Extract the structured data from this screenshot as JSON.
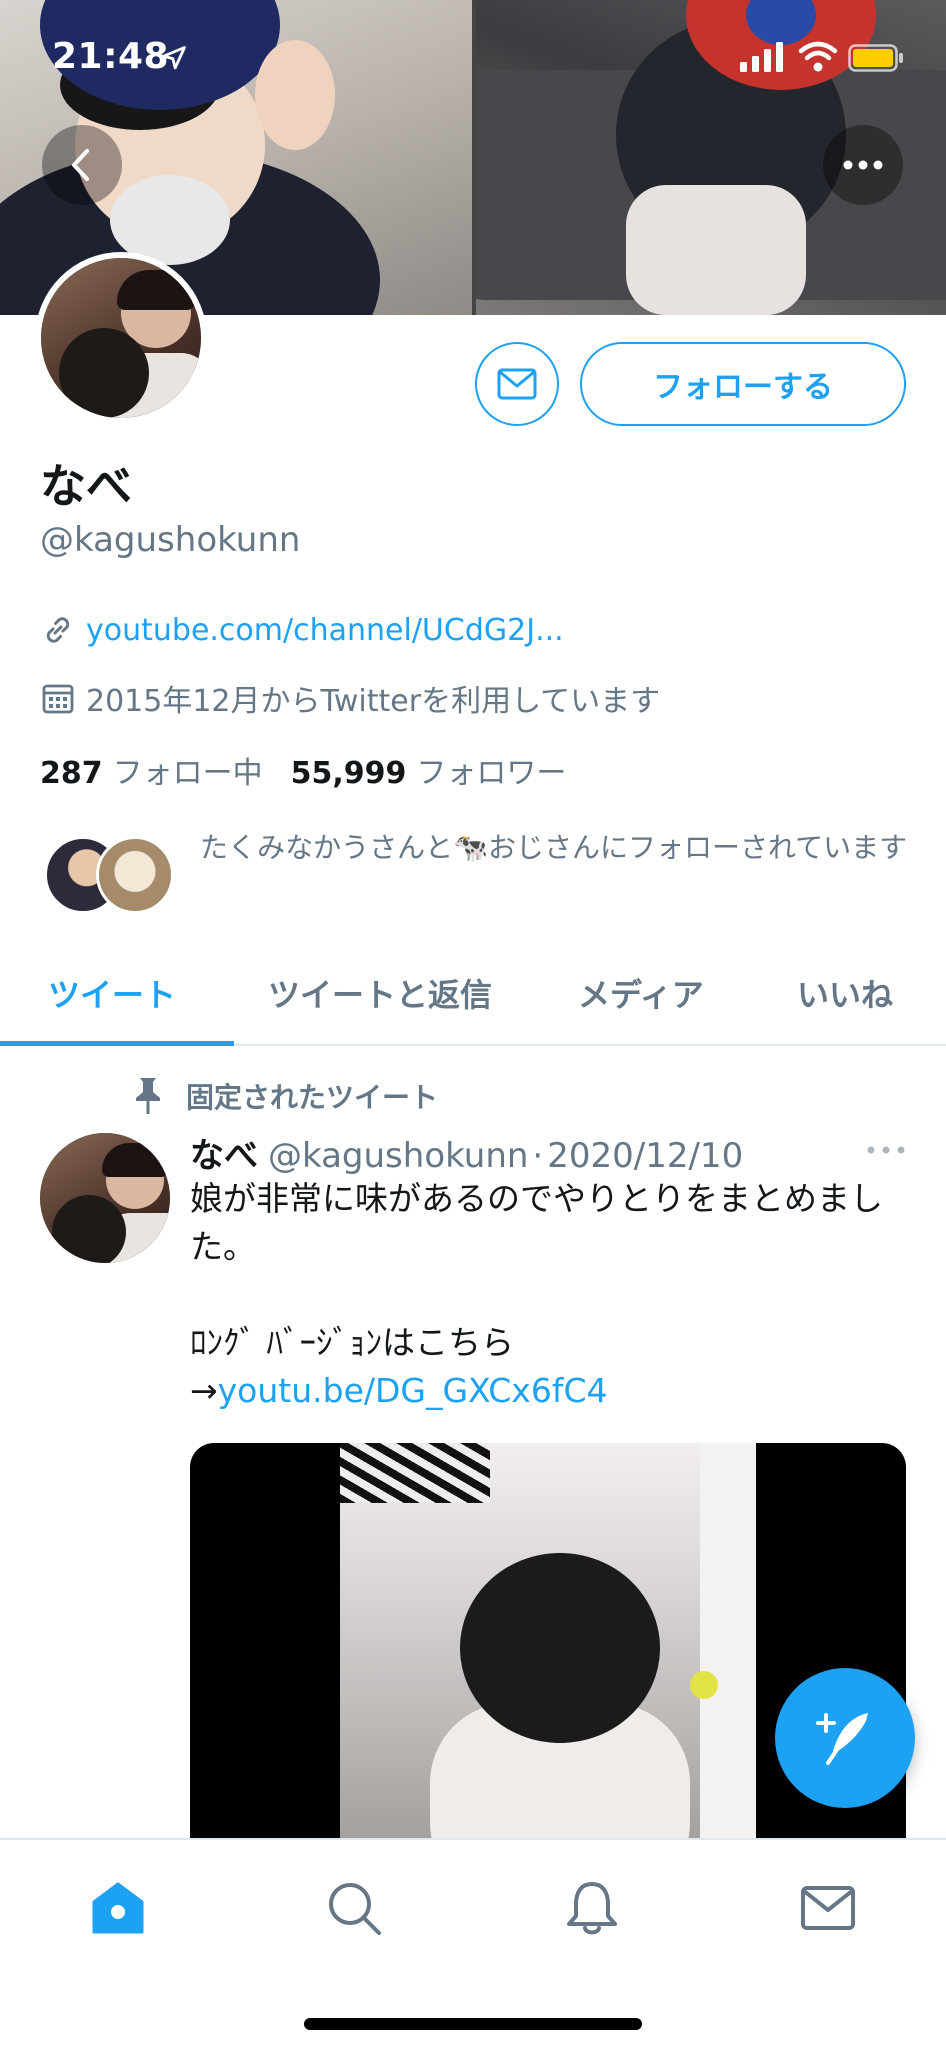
{
  "status_bar": {
    "time": "21:48"
  },
  "profile": {
    "name": "なべ",
    "handle": "@kagushokunn",
    "link": "youtube.com/channel/UCdG2J...",
    "joined": "2015年12月からTwitterを利用しています",
    "following_count": "287",
    "following_label": "フォロー中",
    "followers_count": "55,999",
    "followers_label": "フォロワー",
    "followed_by": "たくみなかうさんと🐄おじさんにフォローされています",
    "follow_button": "フォローする"
  },
  "tabs": [
    {
      "label": "ツイート",
      "active": true
    },
    {
      "label": "ツイートと返信",
      "active": false
    },
    {
      "label": "メディア",
      "active": false
    },
    {
      "label": "いいね",
      "active": false
    }
  ],
  "pinned_tweet": {
    "pinned_label": "固定されたツイート",
    "name": "なべ",
    "handle": "@kagushokunn",
    "dot": "·",
    "date": "2020/12/10",
    "text_line1": "娘が非常に味があるのでやりとりをまとめました。",
    "text_line2_prefix": "ﾛﾝｸﾞ ﾊﾞｰｼﾞｮﾝはこちら→",
    "text_link": "youtu.be/DG_GXCx6fC4"
  },
  "bottom_nav": [
    {
      "icon": "home-icon",
      "active": true
    },
    {
      "icon": "search-icon",
      "active": false
    },
    {
      "icon": "bell-icon",
      "active": false
    },
    {
      "icon": "mail-icon",
      "active": false
    }
  ],
  "colors": {
    "accent": "#1da1f2",
    "secondary_text": "#657786",
    "divider": "#e1e8ed"
  }
}
